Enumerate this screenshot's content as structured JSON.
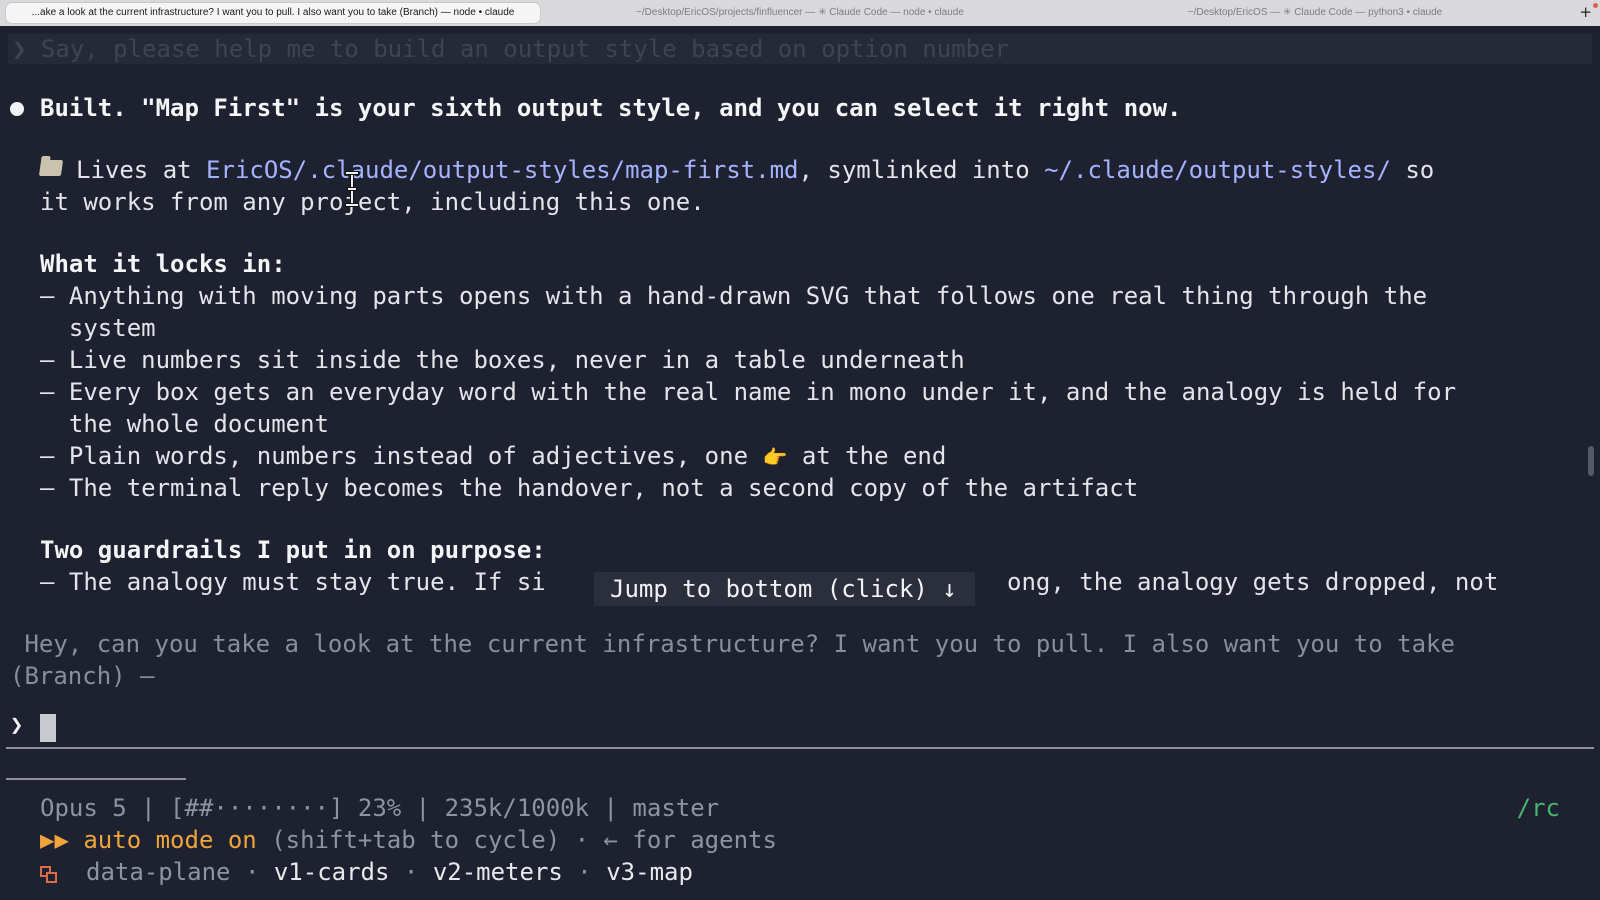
{
  "tabs": [
    {
      "label": "...ake a look at the current infrastructure? I want you to pull. I also want you to take (Branch) — node • claude",
      "active": true
    },
    {
      "label": "~/Desktop/EricOS/projects/finfluencer — ✳ Claude Code — node • claude",
      "active": false
    },
    {
      "label": "~/Desktop/EricOS — ✳ Claude Code — python3 • claude",
      "active": false
    }
  ],
  "new_tab_label": "+",
  "previous_prompt": "❯ Say, please help me to build an output style based on option number",
  "response": {
    "headline": "Built. \"Map First\" is your sixth output style, and you can select it right now.",
    "location": {
      "prefix": "Lives at ",
      "path": "EricOS/.claude/output-styles/map-first.md",
      "middle": ", symlinked into ",
      "link_dir": "~/.claude/output-styles/",
      "suffix": " so",
      "continuation": "it works from any project, including this one."
    },
    "locks_heading": "What it locks in:",
    "locks": [
      "– Anything with moving parts opens with a hand-drawn SVG that follows one real thing through the",
      "  system",
      "– Live numbers sit inside the boxes, never in a table underneath",
      "– Every box gets an everyday word with the real name in mono under it, and the analogy is held for",
      "  the whole document",
      "– Plain words, numbers instead of adjectives, one ",
      "– The terminal reply becomes the handover, not a second copy of the artifact"
    ],
    "locks_hand_suffix": " at the end",
    "hand_emoji": "👉",
    "guardrails_heading": "Two guardrails I put in on purpose:",
    "guardrail_1_visible": "– The analogy must stay true. If si",
    "guardrail_1_tail": "ong, the analogy gets dropped, not"
  },
  "jump_to_bottom_label": "Jump to bottom (click) ↓",
  "queued_message": {
    "line1": " Hey, can you take a look at the current infrastructure? I want you to pull. I also want you to take",
    "line2": "(Branch) —"
  },
  "input_prompt_symbol": "❯",
  "status_bar": {
    "model_line": "Opus 5 | [##········] 23% | 235k/1000k | master",
    "rc_label": "/rc",
    "mode_arrows": "▶▶",
    "mode_label": "auto mode on",
    "mode_hint": " (shift+tab to cycle) · ← for agents",
    "branch_dim": "data-plane",
    "sep": " · ",
    "branches": [
      "v1-cards",
      "v2-meters",
      "v3-map"
    ]
  },
  "colors": {
    "background": "#1e2130",
    "link": "#a5b3ff",
    "accent_orange": "#f0a53a",
    "accent_green": "#47b56c"
  }
}
